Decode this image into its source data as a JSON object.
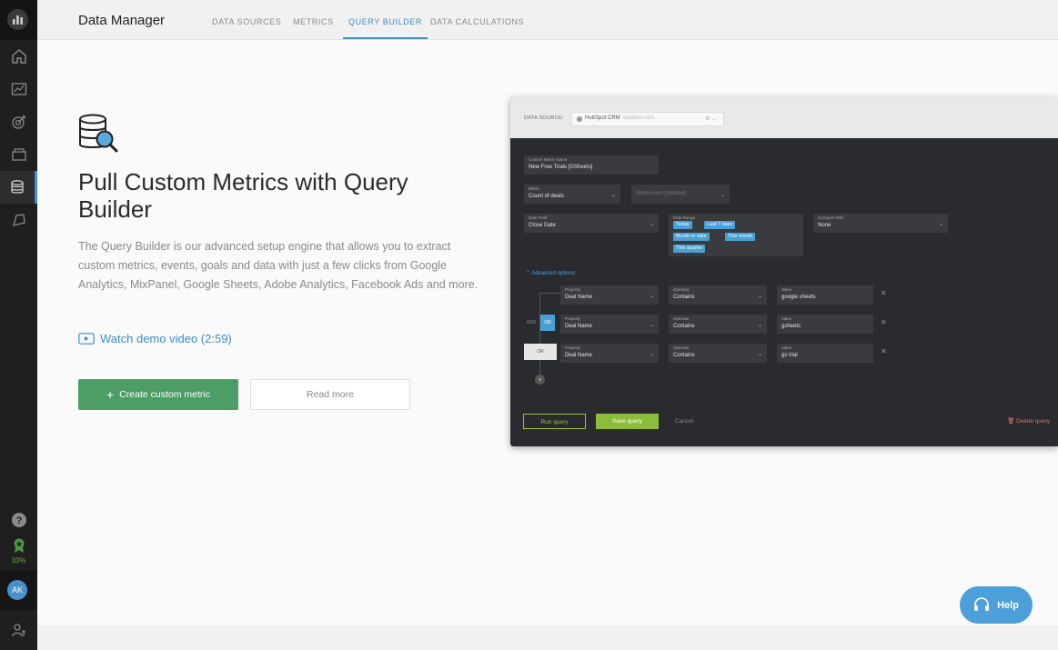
{
  "app": {
    "title": "Data Manager"
  },
  "tabs": [
    {
      "label": "DATA SOURCES",
      "active": false
    },
    {
      "label": "METRICS",
      "active": false
    },
    {
      "label": "QUERY BUILDER",
      "active": true
    },
    {
      "label": "DATA CALCULATIONS",
      "active": false
    }
  ],
  "sidebar": {
    "items": [
      "home-icon",
      "dashboard-icon",
      "goals-icon",
      "connections-icon",
      "data-manager-icon",
      "alerts-icon"
    ],
    "progress_label": "10%",
    "avatar_initials": "AK"
  },
  "hero": {
    "title": "Pull Custom Metrics with Query Builder",
    "description": "The Query Builder is our advanced setup engine that allows you to extract custom metrics, events, goals and data with just a few clicks from Google Analytics, MixPanel, Google Sheets, Adobe Analytics, Facebook Ads and more.",
    "demo_link": "Watch demo video (2:59)",
    "create_button": "Create custom metric",
    "read_more_button": "Read more"
  },
  "preview": {
    "data_source_label": "DATA SOURCE:",
    "data_source_value": "HubSpot CRM",
    "data_source_sub": "databox.com",
    "metric_name_label": "Custom Metric Name",
    "metric_name_value": "New Free Trials [GSheets]",
    "metric_label": "Metric",
    "metric_value": "Count of deals",
    "dimension_placeholder": "Dimension (optional)",
    "date_field_label": "Date Field",
    "date_field_value": "Close Date",
    "date_range_label": "Date Range",
    "date_range_chips": [
      "Today",
      "Last 7 days",
      "Month to date",
      "This month",
      "This quarter"
    ],
    "compare_label": "Compare With",
    "compare_value": "None",
    "advanced_label": "Advanced options",
    "filters": [
      {
        "property_label": "Property",
        "property": "Deal Name",
        "operator_label": "Operator",
        "operator": "Contains",
        "value_label": "Value",
        "value": "google sheets"
      },
      {
        "property_label": "Property",
        "property": "Deal Name",
        "operator_label": "Operator",
        "operator": "Contains",
        "value_label": "Value",
        "value": "gsheets"
      },
      {
        "property_label": "Property",
        "property": "Deal Name",
        "operator_label": "Operator",
        "operator": "Contains",
        "value_label": "Value",
        "value": "gs trial"
      }
    ],
    "logic_and": "AND",
    "logic_or": "OR",
    "logic_or2": "OR",
    "run_button": "Run query",
    "save_button": "Save query",
    "cancel_button": "Cancel",
    "delete_button": "Delete query"
  },
  "help": {
    "label": "Help"
  },
  "colors": {
    "accent": "#3d8fc4",
    "primary_button": "#4e9d67",
    "save_button": "#8bbd3a",
    "help": "#4c9fd8"
  }
}
